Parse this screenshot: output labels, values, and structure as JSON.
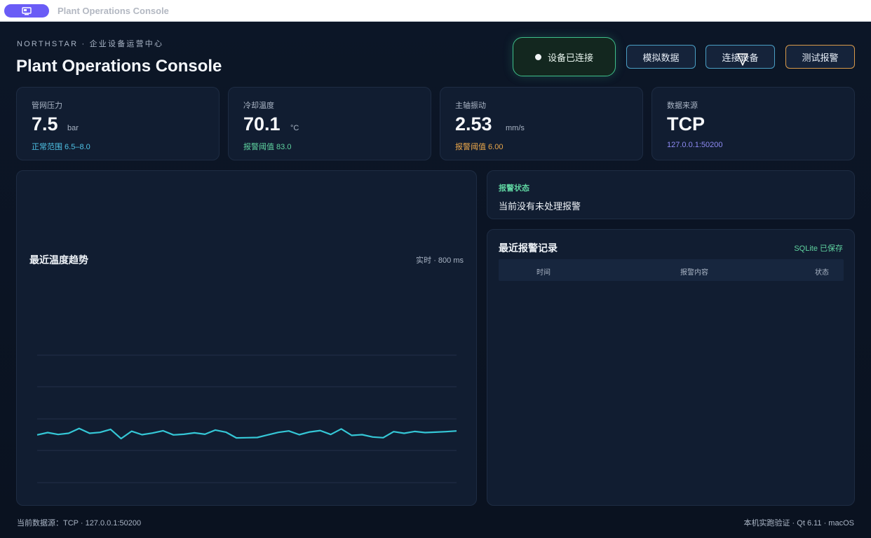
{
  "window": {
    "title": "Plant Operations Console",
    "app_icon": "monitor-icon"
  },
  "header": {
    "brand": "NORTHSTAR · 企业设备运营中心",
    "title": "Plant Operations Console",
    "status": "设备已连接",
    "buttons": {
      "simulate": "模拟数据",
      "connect": "连接设备",
      "test_alarm": "测试报警"
    }
  },
  "metrics": [
    {
      "label": "管网压力",
      "value": "7.5",
      "unit": "bar",
      "sub": "正常范围 6.5–8.0",
      "sub_color": "#4fc3e6"
    },
    {
      "label": "冷却温度",
      "value": "70.1",
      "unit": "°C",
      "sub": "报警阈值 83.0",
      "sub_color": "#5fd3a0"
    },
    {
      "label": "主轴振动",
      "value": "2.53",
      "unit": "mm/s",
      "sub": "报警阈值 6.00",
      "sub_color": "#e9a64a"
    },
    {
      "label": "数据来源",
      "value": "TCP",
      "unit": "",
      "sub": "127.0.0.1:50200",
      "sub_color": "#8f8bf5"
    }
  ],
  "chart": {
    "title": "最近温度趋势",
    "meta": "实时 · 800 ms"
  },
  "chart_data": {
    "type": "line",
    "title": "最近温度趋势",
    "xlabel": "",
    "ylabel": "",
    "grid": true,
    "series": [
      {
        "color": "#35c7d6",
        "values": [
          70.2,
          71.2,
          70.4,
          70.9,
          73.0,
          70.9,
          71.3,
          72.6,
          68.6,
          71.8,
          70.3,
          71.0,
          72.0,
          70.2,
          70.5,
          71.1,
          70.5,
          72.3,
          71.4,
          68.9,
          69.0,
          69.1,
          70.2,
          71.3,
          71.9,
          70.3,
          71.5,
          72.1,
          70.4,
          72.8,
          70.0,
          70.3,
          69.3,
          69.0,
          71.6,
          70.9,
          71.7,
          71.2,
          71.4,
          71.6,
          71.9
        ]
      }
    ]
  },
  "alarm": {
    "label": "报警状态",
    "text": "当前没有未处理报警"
  },
  "records": {
    "title": "最近报警记录",
    "saved": "SQLite 已保存",
    "columns": [
      "时间",
      "报警内容",
      "状态"
    ]
  },
  "footer": {
    "left": "当前数据源：TCP · 127.0.0.1:50200",
    "right": "本机实跑验证 · Qt 6.11 · macOS"
  }
}
